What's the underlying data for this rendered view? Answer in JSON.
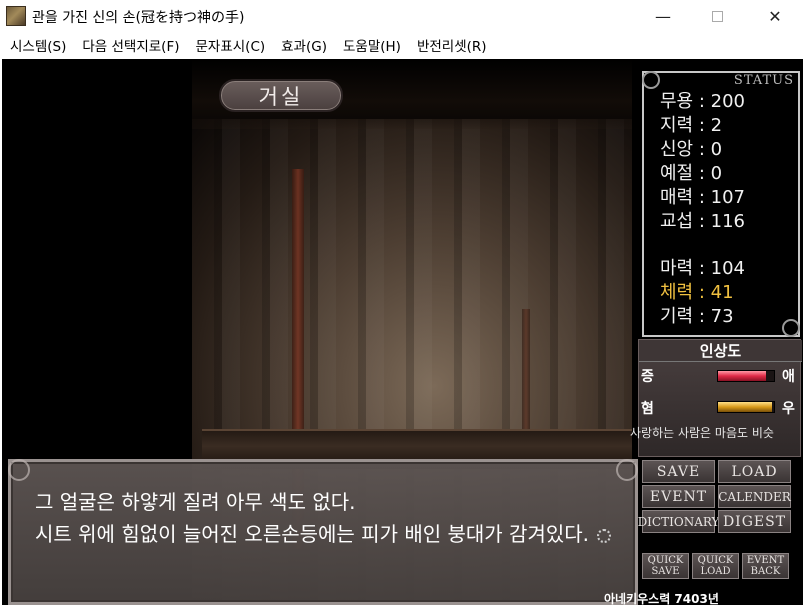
{
  "window": {
    "title": "관을 가진 신의 손(冠を持つ神の手)",
    "minimize_glyph": "—",
    "close_glyph": "✕"
  },
  "menu": [
    {
      "label": "시스템(S)"
    },
    {
      "label": "다음 선택지로(F)"
    },
    {
      "label": "문자표시(C)"
    },
    {
      "label": "효과(G)"
    },
    {
      "label": "도움말(H)"
    },
    {
      "label": "반전리셋(R)"
    }
  ],
  "location": "거실",
  "status": {
    "header": "STATUS",
    "stats": [
      "무용 : 200",
      "지력 : 2",
      "신앙 : 0",
      "예절 : 0",
      "매력 : 107",
      "교섭 : 116",
      "마력 : 104",
      "체력 : 41",
      "기력 : 73"
    ]
  },
  "impression": {
    "title": "인상도",
    "row1_left": "증",
    "row1_right": "애",
    "row1_level": 0.85,
    "row2_left": "혐",
    "row2_right": "우",
    "row2_level": 0.97,
    "quote": "사랑하는 사람은 마음도 비슷"
  },
  "dialog": {
    "lines": [
      "그 얼굴은 하얗게 질려 아무 색도 없다.",
      "시트 위에 힘없이 늘어진 오른손등에는 피가 배인 붕대가 감겨있다."
    ]
  },
  "buttons": {
    "save": "SAVE",
    "load": "LOAD",
    "event": "EVENT",
    "calender": "CALENDER",
    "dictionary": "DICTIONARY",
    "digest": "DIGEST",
    "quick_save": [
      "QUICK",
      "SAVE"
    ],
    "quick_load": [
      "QUICK",
      "LOAD"
    ],
    "event_back": [
      "EVENT",
      "BACK"
    ]
  },
  "time_display": "아네키우스력 7403년",
  "colors": {
    "highlight_stat": "#f0c040",
    "bar_love": "#e02a46",
    "bar_gold": "#d89a1a"
  }
}
